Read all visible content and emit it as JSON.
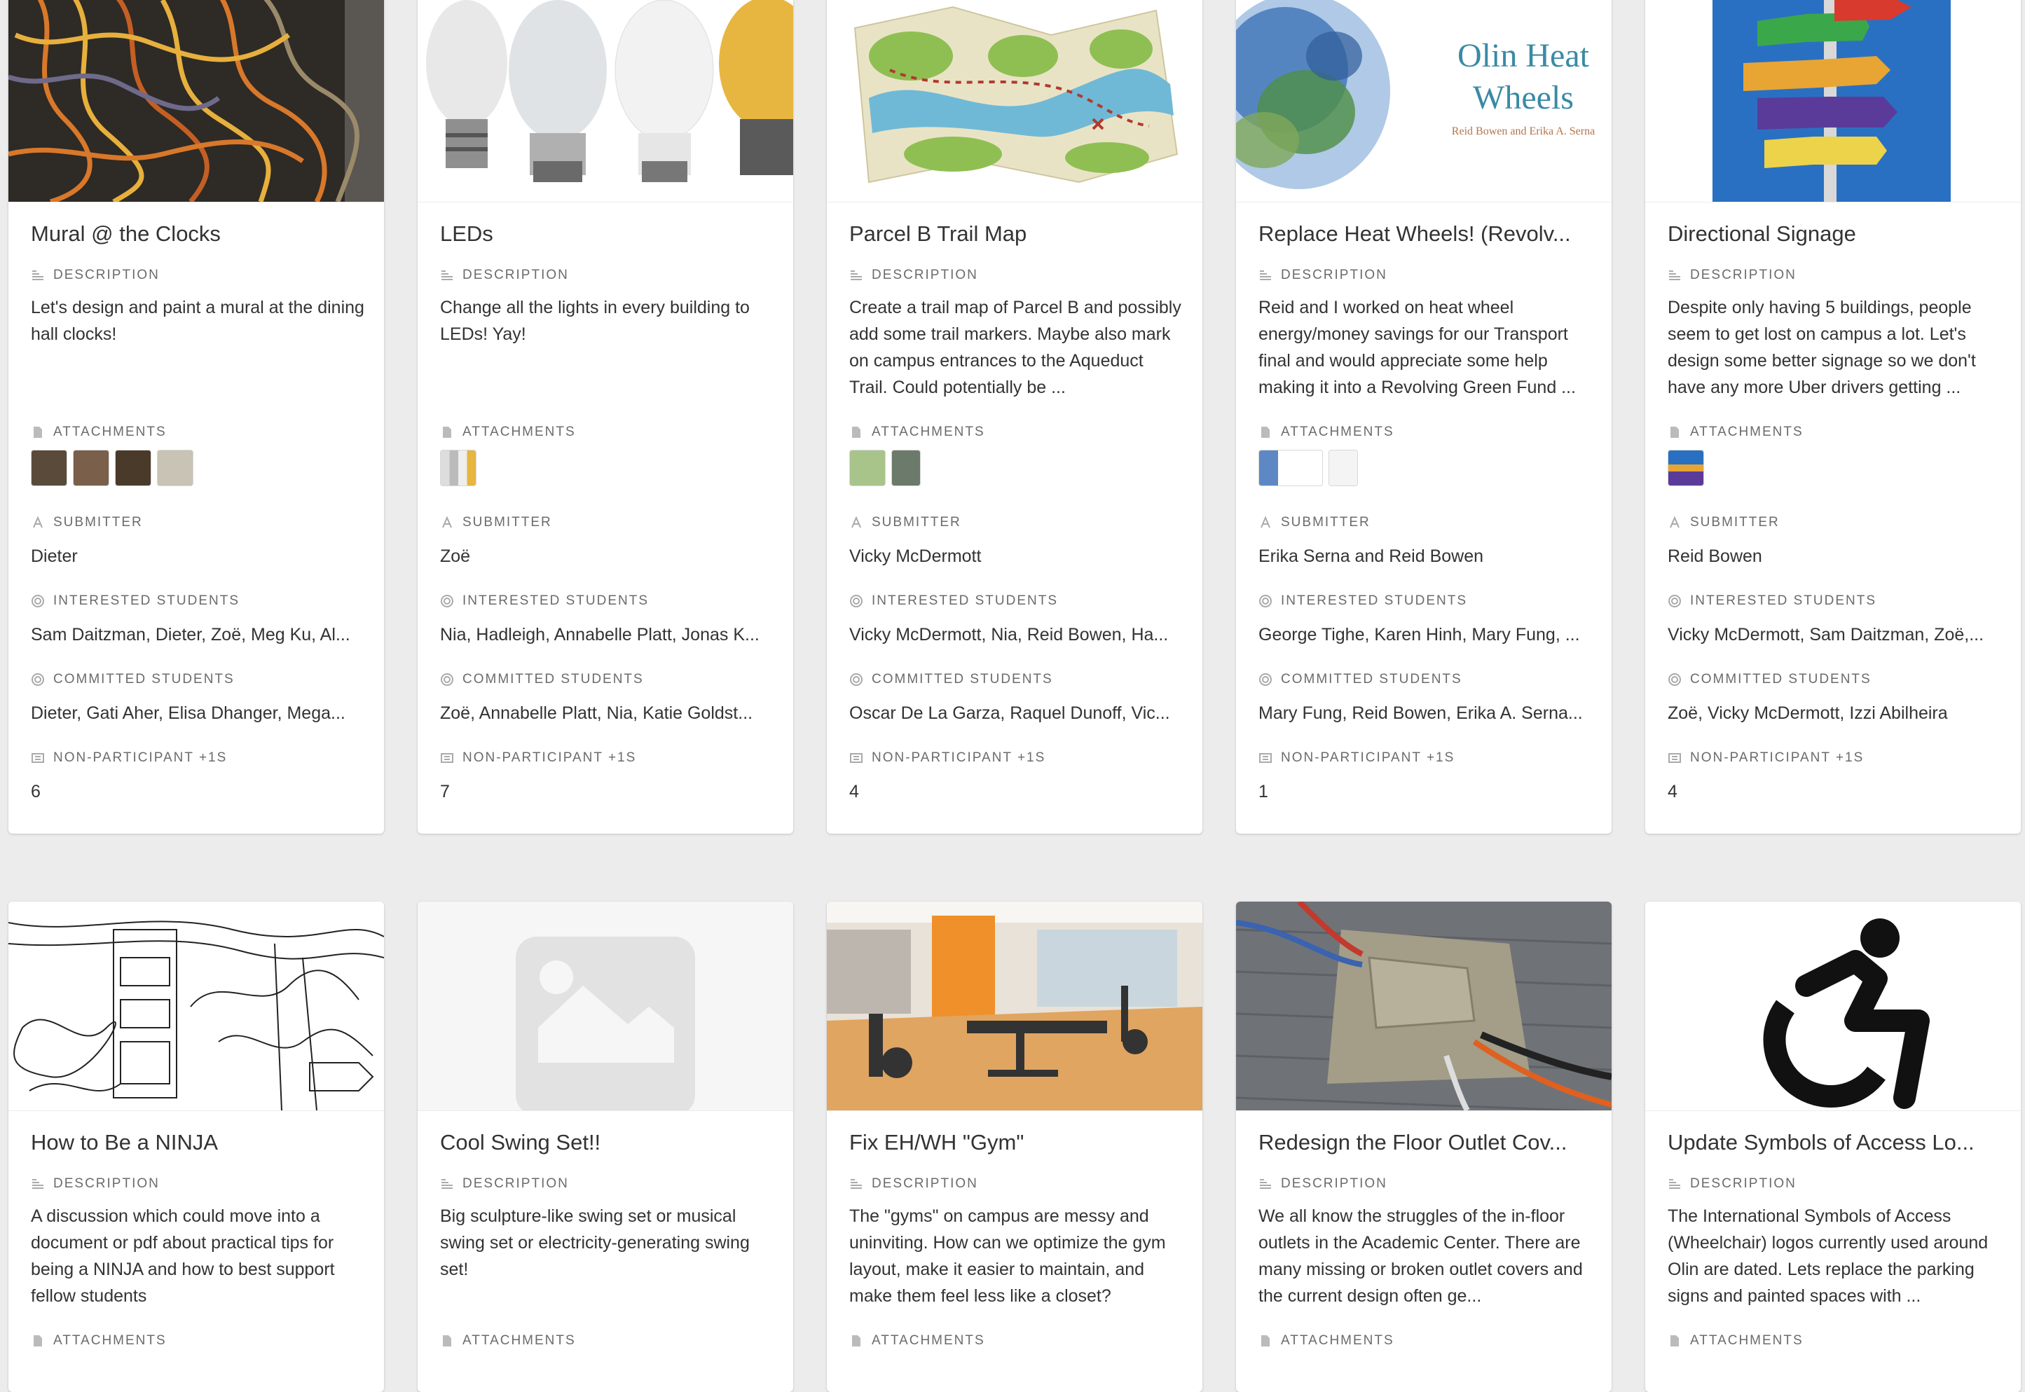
{
  "labels": {
    "description": "DESCRIPTION",
    "attachments": "ATTACHMENTS",
    "submitter": "SUBMITTER",
    "interested": "INTERESTED STUDENTS",
    "committed": "COMMITTED STUDENTS",
    "nonparticipant": "NON-PARTICIPANT +1S"
  },
  "cards": [
    {
      "title": "Mural @ the Clocks",
      "description": "Let's design and paint a mural at the dining hall clocks!",
      "attachments_count": 4,
      "submitter": "Dieter",
      "interested": "Sam Daitzman, Dieter, Zoë, Meg Ku, Al...",
      "committed": "Dieter, Gati Aher, Elisa Dhanger, Mega...",
      "nonparticipant": "6",
      "cover_icon": "mural-image"
    },
    {
      "title": "LEDs",
      "description": "Change all the lights in every building to LEDs! Yay!",
      "attachments_count": 1,
      "submitter": "Zoë",
      "interested": "Nia, Hadleigh, Annabelle Platt, Jonas K...",
      "committed": "Zoë, Annabelle Platt, Nia, Katie Goldst...",
      "nonparticipant": "7",
      "cover_icon": "light-bulbs-image"
    },
    {
      "title": "Parcel B Trail Map",
      "description": "Create a trail map of Parcel B and possibly add some trail markers. Maybe also mark on campus entrances to the Aqueduct Trail. Could potentially be ...",
      "attachments_count": 2,
      "submitter": "Vicky McDermott",
      "interested": "Vicky McDermott, Nia, Reid Bowen, Ha...",
      "committed": "Oscar De La Garza, Raquel Dunoff, Vic...",
      "nonparticipant": "4",
      "cover_icon": "treasure-map-image"
    },
    {
      "title": "Replace Heat Wheels! (Revolv...",
      "description": "Reid and I worked on heat wheel energy/money savings for our Transport final and would appreciate some help making it into a Revolving Green Fund ...",
      "attachments_count": 2,
      "submitter": "Erika Serna and Reid Bowen",
      "interested": "George Tighe, Karen Hinh, Mary Fung, ...",
      "committed": "Mary Fung, Reid Bowen, Erika A. Serna...",
      "nonparticipant": "1",
      "cover_icon": "heat-wheels-cover",
      "cover_title_1": "Olin Heat",
      "cover_title_2": "Wheels",
      "cover_authors": "Reid Bowen and Erika A. Serna"
    },
    {
      "title": "Directional Signage",
      "description": "Despite only having 5 buildings, people seem to get lost on campus a lot. Let's design some better signage so we don't have any more Uber drivers getting ...",
      "attachments_count": 1,
      "submitter": "Reid Bowen",
      "interested": "Vicky McDermott, Sam Daitzman, Zoë,...",
      "committed": "Zoë, Vicky McDermott, Izzi Abilheira",
      "nonparticipant": "4",
      "cover_icon": "signpost-image"
    },
    {
      "title": "How to Be a NINJA",
      "description": "A discussion which could move into a document or pdf about practical tips for being a NINJA and how to best support fellow students",
      "cover_icon": "ninja-sketch-image"
    },
    {
      "title": "Cool Swing Set!!",
      "description": "Big sculpture-like swing set or musical swing set or electricity-generating swing set!",
      "cover_icon": "image-placeholder-icon"
    },
    {
      "title": "Fix EH/WH \"Gym\"",
      "description": "The \"gyms\" on campus are messy and uninviting. How can we optimize the gym layout, make it easier to maintain, and make them feel less like a closet?",
      "cover_icon": "gym-image"
    },
    {
      "title": "Redesign the Floor Outlet Cov...",
      "description": "We all know the struggles of the in-floor outlets in the Academic Center. There are many missing or broken outlet covers and the current design often ge...",
      "cover_icon": "floor-outlet-image"
    },
    {
      "title": "Update Symbols of Access Lo...",
      "description": "The International Symbols of Access (Wheelchair) logos currently used around Olin are dated. Lets replace the parking signs and painted spaces with ...",
      "cover_icon": "accessibility-icon"
    }
  ]
}
